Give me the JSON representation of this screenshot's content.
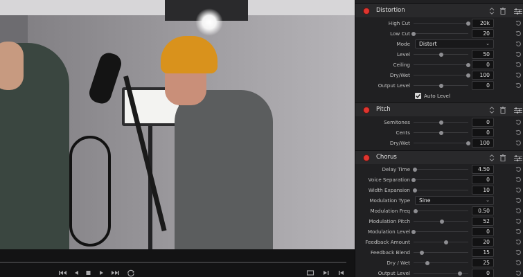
{
  "transport": {
    "icons": [
      "skip-to-start-icon",
      "play-reverse-icon",
      "stop-icon",
      "play-icon",
      "skip-to-end-icon",
      "loop-icon",
      "fullscreen-icon",
      "next-icon",
      "skip-end-icon"
    ]
  },
  "sections": [
    {
      "title": "Distortion",
      "rows": [
        {
          "label": "High Cut",
          "value": "20k",
          "level": 1.0
        },
        {
          "label": "Low Cut",
          "value": "20",
          "level": 0.0
        },
        {
          "label": "Mode",
          "select": "Distort"
        },
        {
          "label": "Level",
          "value": "50",
          "level": 0.5
        },
        {
          "label": "Ceiling",
          "value": "0",
          "level": 1.0
        },
        {
          "label": "Dry/Wet",
          "value": "100",
          "level": 1.0
        },
        {
          "label": "Output Level",
          "value": "0",
          "level": 0.5
        }
      ],
      "checkbox": {
        "label": "Auto Level",
        "checked": true
      }
    },
    {
      "title": "Pitch",
      "rows": [
        {
          "label": "Semitones",
          "value": "0",
          "level": 0.5
        },
        {
          "label": "Cents",
          "value": "0",
          "level": 0.5
        },
        {
          "label": "Dry/Wet",
          "value": "100",
          "level": 1.0
        }
      ]
    },
    {
      "title": "Chorus",
      "rows": [
        {
          "label": "Delay Time",
          "value": "4.50",
          "level": 0.03
        },
        {
          "label": "Voice Separation",
          "value": "0",
          "level": 0.0
        },
        {
          "label": "Width Expansion",
          "value": "10",
          "level": 0.03
        },
        {
          "label": "Modulation Type",
          "select": "Sine"
        },
        {
          "label": "Modulation Freq",
          "value": "0.50",
          "level": 0.04
        },
        {
          "label": "Modulation Pitch",
          "value": "52",
          "level": 0.52
        },
        {
          "label": "Modulation Level",
          "value": "0",
          "level": 0.0
        },
        {
          "label": "Feedback Amount",
          "value": "20",
          "level": 0.6
        },
        {
          "label": "Feedback Blend",
          "value": "15",
          "level": 0.15
        },
        {
          "label": "Dry / Wet",
          "value": "25",
          "level": 0.25
        },
        {
          "label": "Output Level",
          "value": "0",
          "level": 0.85
        }
      ]
    }
  ],
  "colors": {
    "accent_power": "#e0352f",
    "panel_bg": "#202022",
    "header_bg": "#29292b"
  }
}
